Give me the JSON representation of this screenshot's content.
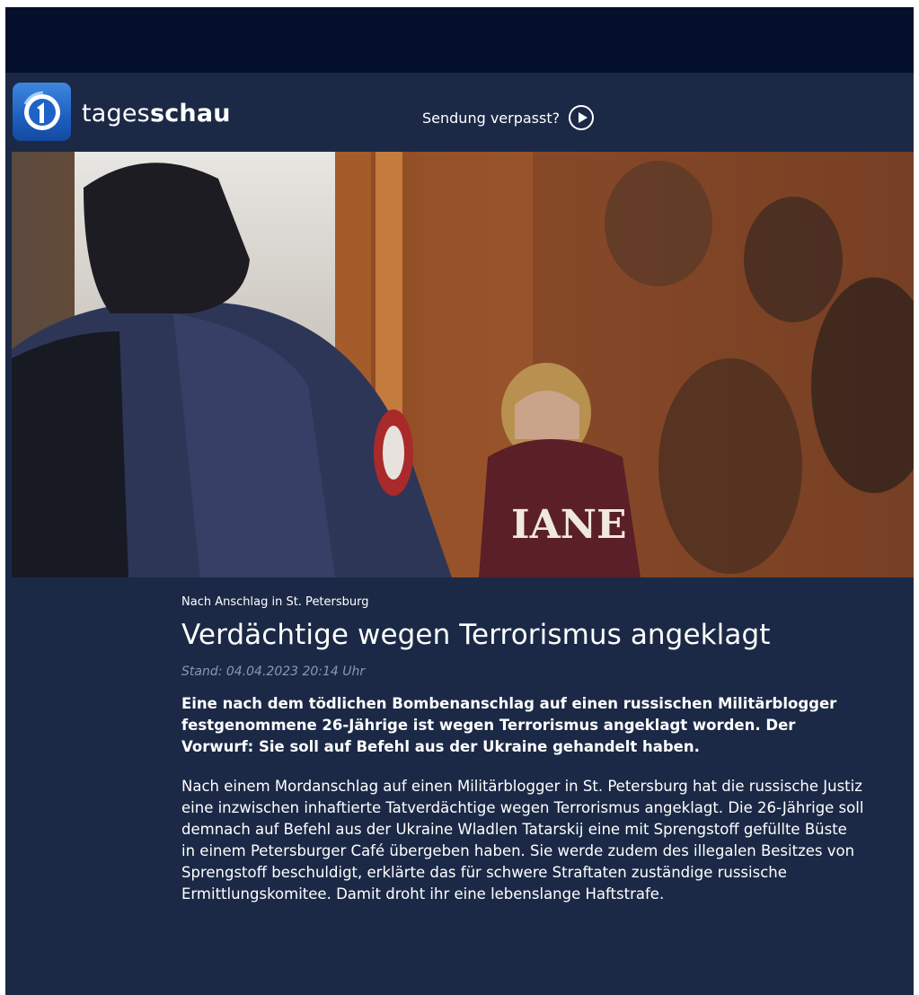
{
  "header": {
    "brand_light": "tages",
    "brand_bold": "schau",
    "missed_label": "Sendung verpasst?"
  },
  "icons": {
    "logo": "ard-one-logo-icon",
    "play": "play-circle-icon"
  },
  "colors": {
    "page_bg": "#1b2946",
    "topbar_bg": "#04102b",
    "logo_blue": "#2b6fd2",
    "date_grey": "#8d97ab"
  },
  "article": {
    "topline": "Nach Anschlag in St. Petersburg",
    "headline": "Verdächtige wegen Terrorismus angeklagt",
    "stand": "Stand: 04.04.2023 20:14 Uhr",
    "lead": "Eine nach dem tödlichen Bombenanschlag auf einen russischen Militärblogger festgenommene 26-Jährige ist wegen Terrorismus angeklagt worden. Der Vorwurf: Sie soll auf Befehl aus der Ukraine gehandelt haben.",
    "body": "Nach einem Mordanschlag auf einen Militärblogger in St. Petersburg hat die russische Justiz eine inzwischen inhaftierte Tatverdächtige wegen Terrorismus angeklagt. Die 26-Jährige soll demnach auf Befehl aus der Ukraine Wladlen Tatarskij eine mit Sprengstoff gefüllte Büste in einem Petersburger Café übergeben haben. Sie werde zudem des illegalen Besitzes von Sprengstoff beschuldigt, erklärte das für schwere Straftaten zuständige russische Ermittlungskomitee. Damit droht ihr eine lebenslange Haftstrafe."
  }
}
